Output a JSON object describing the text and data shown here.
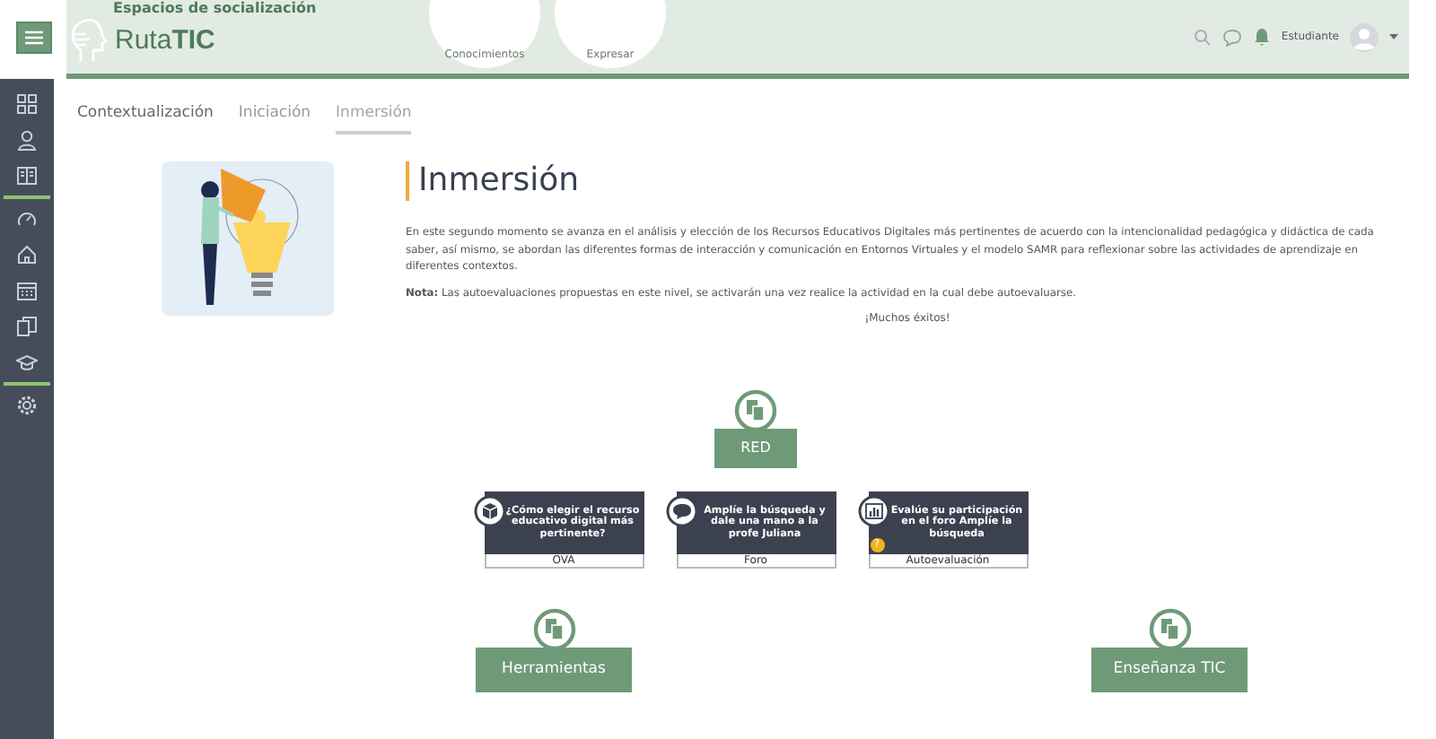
{
  "header": {
    "title": "Espacios de socialización",
    "brand": "Ruta**TIC**",
    "circles": [
      "Conocimientos",
      "Expresar"
    ],
    "user": "Estudiante"
  },
  "tabs": [
    {
      "label": "Contextualización",
      "selected": false
    },
    {
      "label": "Iniciación",
      "selected": false
    },
    {
      "label": "Inmersión",
      "selected": true
    }
  ],
  "intro": {
    "title": "Inmersión",
    "paragraphs": [
      "En este segundo momento se avanza en el análisis y elección de los Recursos Educativos Digitales más pertinentes de acuerdo con la intencionalidad pedagógica y didáctica de cada saber, así mismo, se abordan las diferentes formas de interacción y comunicación en Entornos Virtuales y el modelo SAMR para reflexionar sobre las actividades de aprendizaje en diferentes contextos.",
      "**Nota:** Las autoevaluaciones propuestas en este nivel, se activarán una vez realice la actividad en la cual debe autoevaluarse."
    ],
    "closing": "¡Muchos éxitos!"
  },
  "map": {
    "root": "RED",
    "activities": [
      {
        "kind": "package",
        "title": "¿Cómo elegir el recurso educativo digital más pertinente?",
        "type": "OVA"
      },
      {
        "kind": "forum",
        "title": "Amplíe la búsqueda y dale una mano a la profe Juliana",
        "type": "Foro"
      },
      {
        "kind": "quiz",
        "title": "Evalúe su participación en el foro Amplíe la búsqueda",
        "type": "Autoevaluación",
        "badge": "?"
      }
    ],
    "branches": [
      "Herramientas",
      "Enseñanza TIC"
    ]
  }
}
